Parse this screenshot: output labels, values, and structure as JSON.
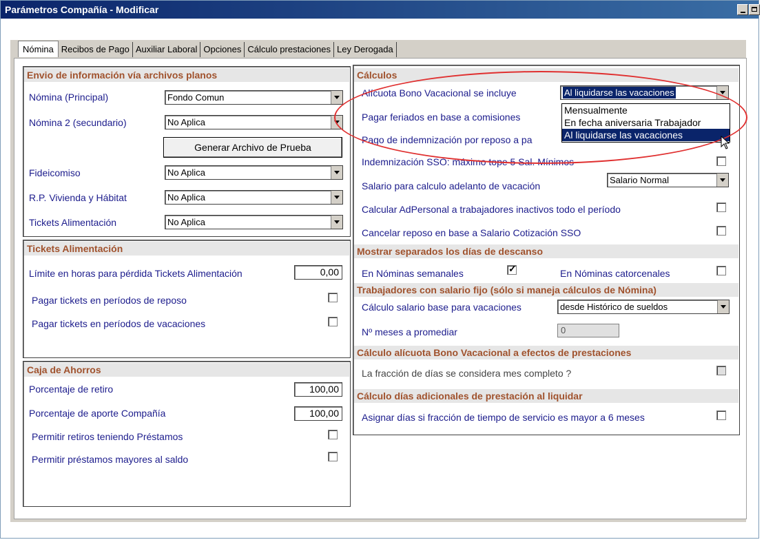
{
  "window": {
    "title": "Parámetros Compañía - Modificar"
  },
  "tabs": [
    {
      "label": "Nómina"
    },
    {
      "label": "Recibos de Pago"
    },
    {
      "label": "Auxiliar Laboral"
    },
    {
      "label": "Opciones"
    },
    {
      "label": "Cálculo prestaciones"
    },
    {
      "label": "Ley Derogada"
    }
  ],
  "envio": {
    "header": "Envio de información vía archivos planos",
    "nomina_principal_label": "Nómina (Principal)",
    "nomina_principal_value": "Fondo Comun",
    "nomina2_label": "Nómina 2  (secundario)",
    "nomina2_value": "No Aplica",
    "generar_button": "Generar Archivo de Prueba",
    "fideicomiso_label": "Fideicomiso",
    "fideicomiso_value": "No Aplica",
    "vivienda_label": "R.P. Vivienda y Hábitat",
    "vivienda_value": "No Aplica",
    "tickets_label": "Tickets Alimentación",
    "tickets_value": "No Aplica"
  },
  "tickets": {
    "header": "Tickets Alimentación",
    "limite_label": "Límite en horas para pérdida Tickets Alimentación",
    "limite_value": "0,00",
    "reposo_label": "Pagar tickets  en períodos de reposo",
    "vacaciones_label": "Pagar tickets  en períodos de vacaciones"
  },
  "caja": {
    "header": "Caja de Ahorros",
    "retiro_label": "Porcentaje de retiro",
    "retiro_value": "100,00",
    "aporte_label": "Porcentaje de aporte Compañía",
    "aporte_value": "100,00",
    "permitir_retiros_label": "Permitir retiros teniendo Préstamos",
    "permitir_prestamos_label": "Permitir préstamos mayores al saldo"
  },
  "calculos": {
    "header": "Cálculos",
    "alicuota_label": "Alícuota Bono Vacacional se incluye",
    "alicuota_value": "Al liquidarse las vacaciones",
    "alicuota_options": [
      "Mensualmente",
      "En fecha aniversaria Trabajador",
      "Al liquidarse las vacaciones"
    ],
    "feriados_label": "Pagar feriados en base a comisiones",
    "indemnizacion_label": "Pago de indemnización por reposo a pa",
    "sso_label": "Indemnización SSO: máximo tope 5 Sal. Mínimos",
    "salario_adelanto_label": "Salario para calculo adelanto de vacación",
    "salario_adelanto_value": "Salario Normal",
    "adpersonal_label": "Calcular AdPersonal a trabajadores inactivos todo el período",
    "cancelar_reposo_label": "Cancelar reposo en base a  Salario Cotización SSO"
  },
  "descanso": {
    "header": "Mostrar separados los días de descanso",
    "semanales_label": "En Nóminas  semanales",
    "semanales_checked": true,
    "catorcenales_label": "En Nóminas catorcenales"
  },
  "salario_fijo": {
    "header": "Trabajadores con salario fijo (sólo si maneja cálculos de Nómina)",
    "base_label": "Cálculo salario base para vacaciones",
    "base_value": "desde Histórico de sueldos",
    "meses_label": "Nº meses a promediar",
    "meses_value": "0"
  },
  "alicuota_prest": {
    "header": "Cálculo alícuota Bono Vacacional a efectos de prestaciones",
    "fraccion_label": "La fracción de días se considera mes completo ?"
  },
  "dias_adicionales": {
    "header": "Cálculo días adicionales de prestación al liquidar",
    "asignar_label": "Asignar días si  fracción de tiempo de servicio es mayor a  6 meses"
  },
  "colors": {
    "header_text": "#a0522d",
    "label_text": "#1c1c8c",
    "selection": "#0a246a",
    "highlight_ellipse": "#e03030"
  }
}
